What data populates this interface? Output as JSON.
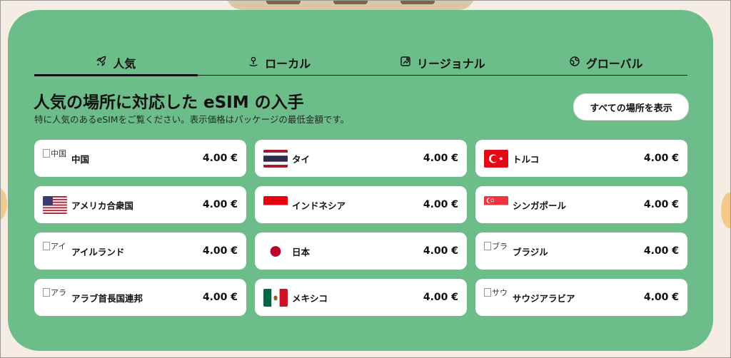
{
  "tabs": [
    {
      "label": "人気",
      "icon": "rocket-icon",
      "active": true
    },
    {
      "label": "ローカル",
      "icon": "pin-icon",
      "active": false
    },
    {
      "label": "リージョナル",
      "icon": "map-icon",
      "active": false
    },
    {
      "label": "グローバル",
      "icon": "globe-icon",
      "active": false
    }
  ],
  "heading": "人気の場所に対応した eSIM の入手",
  "subheading": "特に人気のあるeSIMをご覧ください。表示価格はパッケージの最低金額です。",
  "show_all_label": "すべての場所を表示",
  "colors": {
    "panel": "#6cbd8a",
    "card": "#ffffff",
    "text": "#111111"
  },
  "destinations": [
    {
      "name": "中国",
      "price": "4.00 €",
      "flag": "broken",
      "alt": "中国"
    },
    {
      "name": "タイ",
      "price": "4.00 €",
      "flag": "thailand"
    },
    {
      "name": "トルコ",
      "price": "4.00 €",
      "flag": "turkey"
    },
    {
      "name": "アメリカ合衆国",
      "price": "4.00 €",
      "flag": "usa"
    },
    {
      "name": "インドネシア",
      "price": "4.00 €",
      "flag": "indonesia"
    },
    {
      "name": "シンガポール",
      "price": "4.00 €",
      "flag": "singapore"
    },
    {
      "name": "アイルランド",
      "price": "4.00 €",
      "flag": "broken",
      "alt": "アイ"
    },
    {
      "name": "日本",
      "price": "4.00 €",
      "flag": "japan"
    },
    {
      "name": "ブラジル",
      "price": "4.00 €",
      "flag": "broken",
      "alt": "ブラ"
    },
    {
      "name": "アラブ首長国連邦",
      "price": "4.00 €",
      "flag": "broken",
      "alt": "アラ"
    },
    {
      "name": "メキシコ",
      "price": "4.00 €",
      "flag": "mexico"
    },
    {
      "name": "サウジアラビア",
      "price": "4.00 €",
      "flag": "broken",
      "alt": "サウ"
    }
  ]
}
